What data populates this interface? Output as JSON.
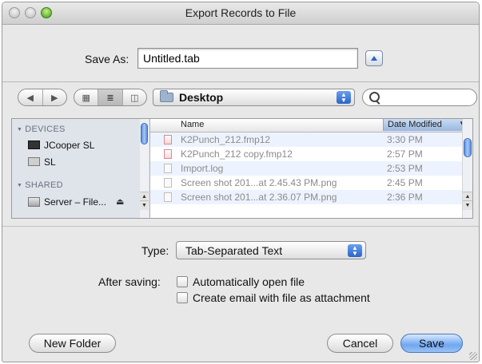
{
  "window": {
    "title": "Export Records to File"
  },
  "save_as": {
    "label": "Save As:",
    "value": "Untitled.tab"
  },
  "toolbar": {
    "back_glyph": "◀",
    "forward_glyph": "▶",
    "view_icon_glyph": "▦",
    "view_list_glyph": "≣",
    "view_column_glyph": "◫",
    "location": "Desktop",
    "search_value": ""
  },
  "sidebar": {
    "devices_heading": "DEVICES",
    "shared_heading": "SHARED",
    "devices": [
      {
        "label": "JCooper SL",
        "icon": "computer-icon"
      },
      {
        "label": "SL",
        "icon": "disk-icon"
      }
    ],
    "shared": [
      {
        "label": "Server – File...",
        "icon": "network-server-icon"
      }
    ]
  },
  "file_list": {
    "columns": {
      "name": "Name",
      "date": "Date Modified"
    },
    "rows": [
      {
        "name": "K2Punch_212.fmp12",
        "date": "3:30 PM",
        "icon": "filemaker-file-icon"
      },
      {
        "name": "K2Punch_212 copy.fmp12",
        "date": "2:57 PM",
        "icon": "filemaker-file-icon"
      },
      {
        "name": "Import.log",
        "date": "2:53 PM",
        "icon": "document-icon"
      },
      {
        "name": "Screen shot 201...at 2.45.43 PM.png",
        "date": "2:45 PM",
        "icon": "image-file-icon"
      },
      {
        "name": "Screen shot 201...at 2.36.07 PM.png",
        "date": "2:36 PM",
        "icon": "image-file-icon"
      }
    ]
  },
  "options": {
    "type_label": "Type:",
    "type_value": "Tab-Separated Text",
    "after_saving_label": "After saving:",
    "auto_open_label": "Automatically open file",
    "auto_open_checked": false,
    "email_label": "Create email with file as attachment",
    "email_checked": false
  },
  "buttons": {
    "new_folder": "New Folder",
    "cancel": "Cancel",
    "save": "Save"
  }
}
